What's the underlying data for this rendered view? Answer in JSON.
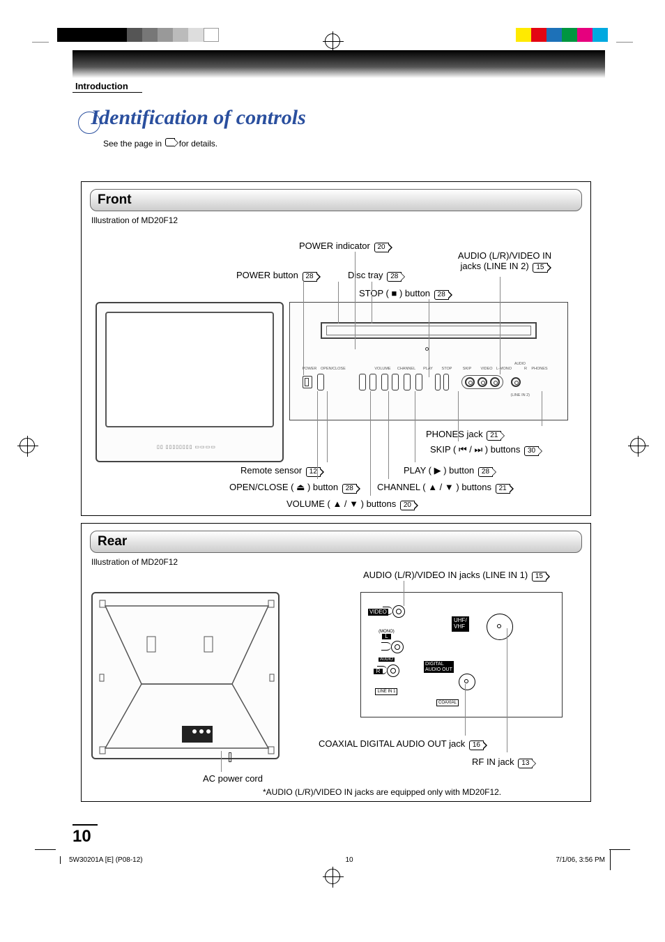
{
  "section": "Introduction",
  "title": "Identification of controls",
  "subtitle_pre": "See the page in",
  "subtitle_post": "for details.",
  "front": {
    "heading": "Front",
    "illustration": "Illustration of MD20F12",
    "labels": {
      "power_indicator": "POWER indicator",
      "power_indicator_pg": "20",
      "audio_in": "AUDIO (L/R)/VIDEO IN",
      "audio_in2": "jacks (LINE IN 2)",
      "audio_in_pg": "15",
      "power_button": "POWER button",
      "power_button_pg": "28",
      "disc_tray": "Disc tray",
      "disc_tray_pg": "28",
      "stop_button": "STOP ( ■ ) button",
      "stop_button_pg": "28",
      "phones": "PHONES jack",
      "phones_pg": "21",
      "skip": "SKIP ( ⏮ / ⏭ ) buttons",
      "skip_pg": "30",
      "remote": "Remote sensor",
      "remote_pg": "12",
      "play": "PLAY ( ▶ ) button",
      "play_pg": "28",
      "open_close": "OPEN/CLOSE ( ⏏ ) button",
      "open_close_pg": "28",
      "channel": "CHANNEL ( ▲ / ▼ ) buttons",
      "channel_pg": "21",
      "volume": "VOLUME ( ▲ / ▼ ) buttons",
      "volume_pg": "20"
    },
    "btn_labels": {
      "power": "POWER",
      "openclose": "OPEN/CLOSE",
      "volume": "VOLUME",
      "channel": "CHANNEL",
      "play": "PLAY",
      "stop": "STOP",
      "skip": "SKIP",
      "video": "VIDEO",
      "laudio": "L-MONO",
      "audio": "AUDIO",
      "r": "R",
      "phones": "PHONES",
      "linein2": "(LINE IN 2)"
    }
  },
  "rear": {
    "heading": "Rear",
    "illustration": "Illustration of MD20F12",
    "audio_in1": "AUDIO (L/R)/VIDEO IN jacks (LINE IN 1)",
    "audio_in1_pg": "15",
    "coax": "COAXIAL DIGITAL AUDIO OUT jack",
    "coax_pg": "16",
    "rf": "RF IN jack",
    "rf_pg": "13",
    "ac": "AC power cord",
    "note": "*AUDIO (L/R)/VIDEO IN jacks are equipped only with MD20F12.",
    "jacks": {
      "video": "VIDEO",
      "mono": "(MONO)",
      "l": "L",
      "audio": "AUDIO",
      "r": "R",
      "linein1": "LINE IN 1",
      "uhfvhf": "UHF/\nVHF",
      "digital": "DIGITAL\nAUDIO OUT",
      "coaxial": "COAXIAL"
    }
  },
  "page_number": "10",
  "footer": {
    "left": "5W30201A [E] (P08-12)",
    "center": "10",
    "right": "7/1/06, 3:56 PM"
  }
}
